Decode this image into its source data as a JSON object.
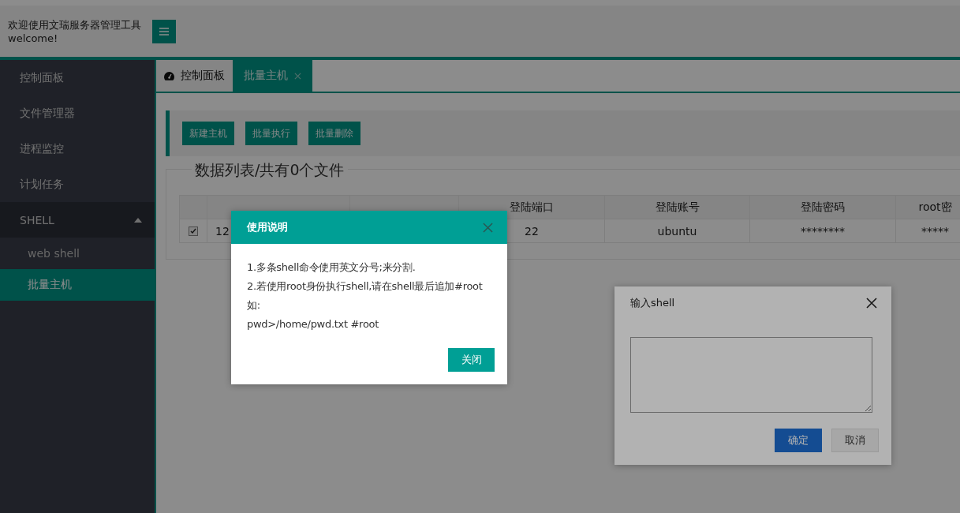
{
  "header": {
    "title": "欢迎使用文瑞服务器管理工具",
    "subtitle": "welcome!"
  },
  "sidebar": {
    "items": [
      {
        "label": "控制面板",
        "selected": false
      },
      {
        "label": "文件管理器",
        "selected": false
      },
      {
        "label": "进程监控",
        "selected": false
      },
      {
        "label": "计划任务",
        "selected": false
      },
      {
        "label": "SHELL",
        "selected": false,
        "expanded": true,
        "children": [
          {
            "label": "web shell",
            "selected": false
          },
          {
            "label": "批量主机",
            "selected": true
          }
        ]
      }
    ]
  },
  "tabs": [
    {
      "label": "控制面板",
      "selected": false
    },
    {
      "label": "批量主机",
      "selected": true
    }
  ],
  "toolbar": {
    "buttons": [
      "新建主机",
      "批量执行",
      "批量删除"
    ]
  },
  "legend": "数据列表/共有0个文件",
  "table": {
    "columns": [
      "",
      "",
      "",
      "登陆端口",
      "登陆账号",
      "登陆密码",
      "root密"
    ],
    "rows": [
      {
        "selected": true,
        "cells": [
          "",
          "12",
          "",
          "22",
          "ubuntu",
          "********",
          "*****"
        ]
      }
    ]
  },
  "shell_dialog": {
    "title": "输入shell",
    "buttons": [
      "确定",
      "取消"
    ]
  },
  "help_dialog": {
    "title": "使用说明",
    "lines": [
      "1.多条shell命令使用英文分号;来分割.",
      "2.若使用root身份执行shell,请在shell最后追加#root",
      "如:",
      "pwd>/home/pwd.txt #root"
    ],
    "button": "关闭"
  }
}
